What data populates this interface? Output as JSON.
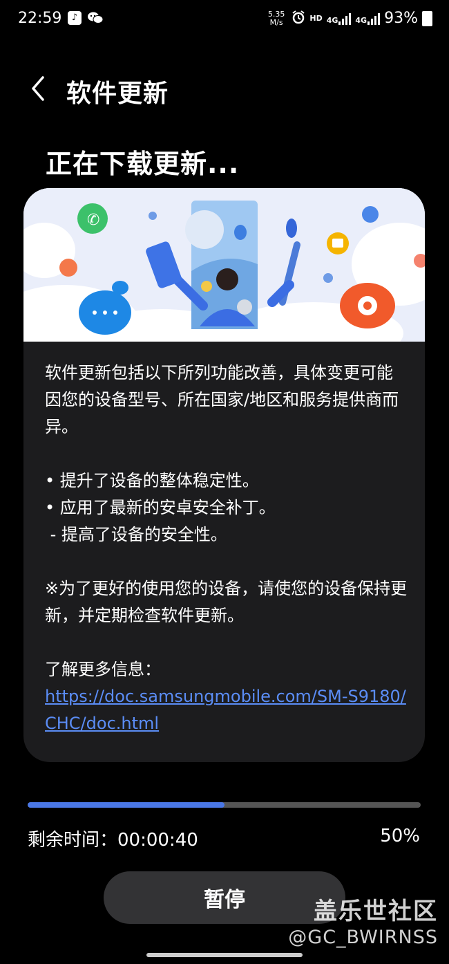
{
  "status_bar": {
    "time": "22:59",
    "speed_value": "5.35",
    "speed_unit": "M/s",
    "hd": "HD",
    "net1": "4G",
    "net2": "4G",
    "battery": "93%"
  },
  "header": {
    "title": "软件更新"
  },
  "status_title": "正在下载更新...",
  "card": {
    "intro": "软件更新包括以下所列功能改善，具体变更可能因您的设备型号、所在国家/地区和服务提供商而异。",
    "bullet1": "• 提升了设备的整体稳定性。",
    "bullet2": "• 应用了最新的安卓安全补丁。",
    "bullet3": " - 提高了设备的安全性。",
    "note": "※为了更好的使用您的设备，请使您的设备保持更新，并定期检查软件更新。",
    "more_label": "了解更多信息：",
    "more_link": "https://doc.samsungmobile.com/SM-S9180/CHC/doc.html"
  },
  "progress": {
    "fraction": 0.5,
    "time_left": "剩余时间：00:00:40",
    "percent": "50%"
  },
  "pause_button": "暂停",
  "watermark": {
    "line1": "盖乐世社区",
    "line2": "@GC_BWIRNSS"
  },
  "colors": {
    "accent": "#4a77e6",
    "link": "#5b8df6",
    "card_bg": "#1c1c1e",
    "button_bg": "#333335"
  }
}
